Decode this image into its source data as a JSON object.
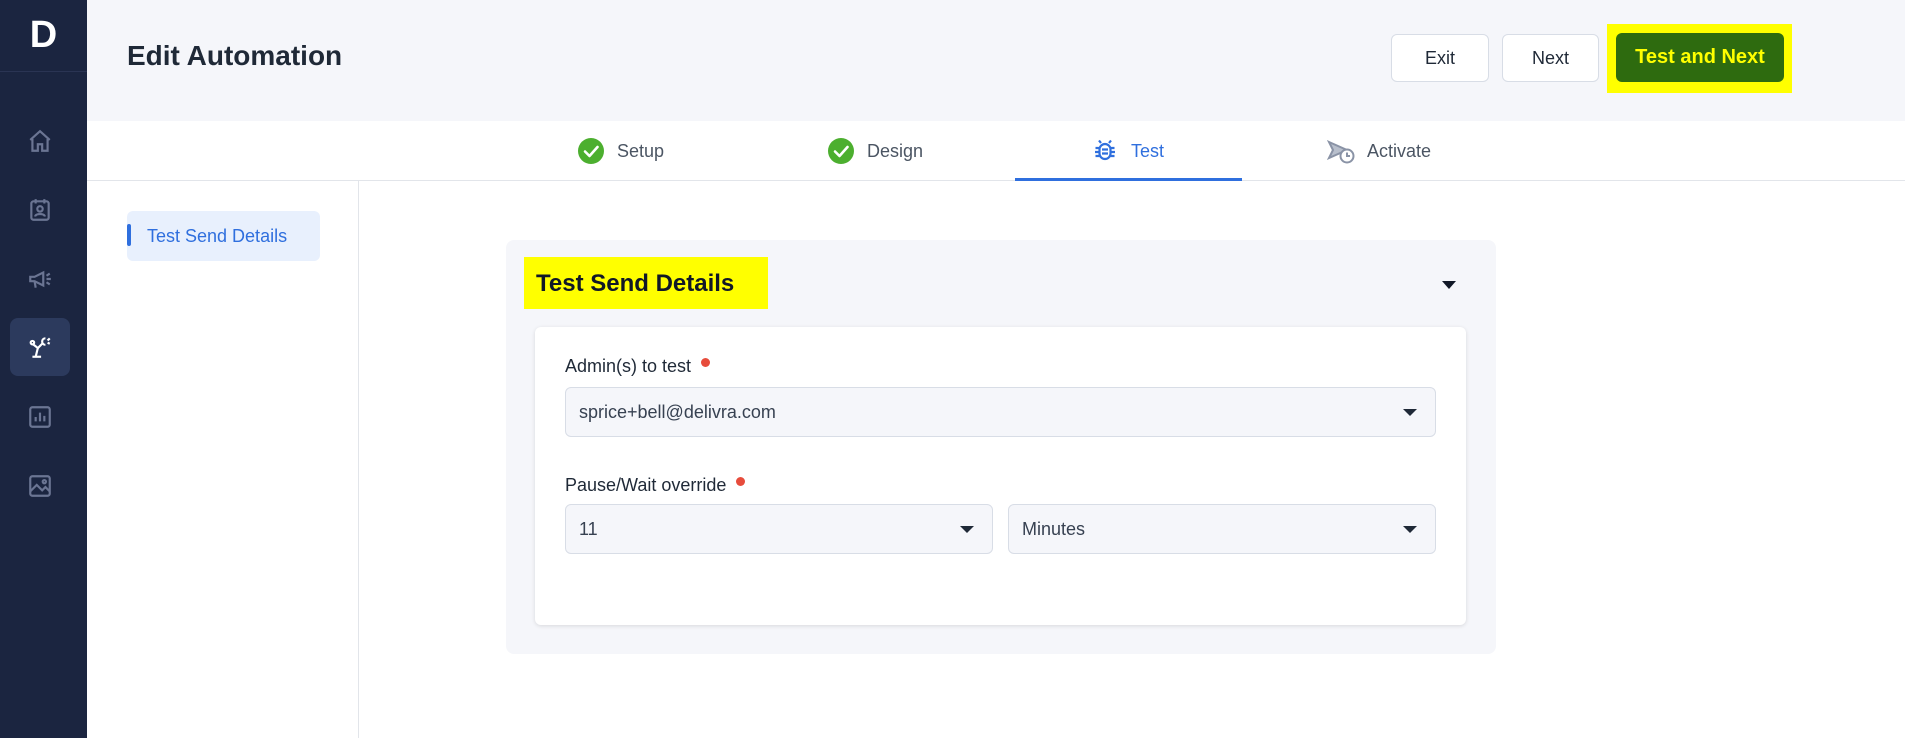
{
  "app": {
    "logo_letter": "D"
  },
  "rail": {
    "items": [
      {
        "icon": "home-icon"
      },
      {
        "icon": "contacts-icon"
      },
      {
        "icon": "campaign-icon"
      },
      {
        "icon": "automation-icon",
        "active": true
      },
      {
        "icon": "reports-icon"
      },
      {
        "icon": "image-gallery-icon"
      }
    ]
  },
  "header": {
    "title": "Edit Automation",
    "exit_label": "Exit",
    "next_label": "Next",
    "primary_label": "Test and Next"
  },
  "steps": [
    {
      "label": "Setup",
      "status": "complete"
    },
    {
      "label": "Design",
      "status": "complete"
    },
    {
      "label": "Test",
      "status": "active"
    },
    {
      "label": "Activate",
      "status": "pending"
    }
  ],
  "subnav": {
    "items": [
      {
        "label": "Test Send Details",
        "active": true
      }
    ]
  },
  "panel": {
    "title": "Test Send Details",
    "admins": {
      "label": "Admin(s) to test",
      "value": "sprice+bell@delivra.com"
    },
    "pause": {
      "label": "Pause/Wait override",
      "amount": "11",
      "unit": "Minutes"
    }
  },
  "colors": {
    "rail_bg": "#1b2540",
    "accent_blue": "#2f6fde",
    "primary_button": "#2e6b0f",
    "highlight": "#ffff00",
    "success_green": "#4caf2f",
    "required_dot": "#e74c3c"
  }
}
